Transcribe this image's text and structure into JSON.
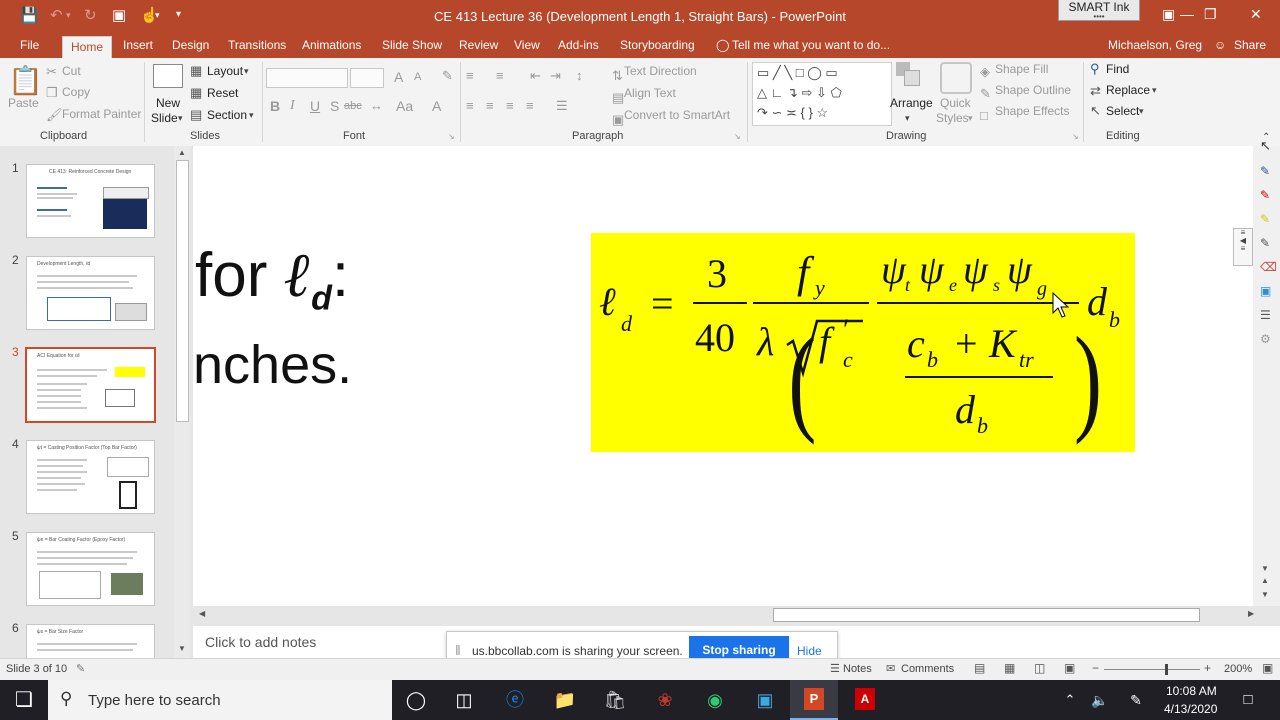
{
  "title_bar": {
    "title": "CE 413 Lecture 36 (Development Length 1, Straight Bars) - PowerPoint",
    "smart_ink_label": "SMART Ink"
  },
  "tabs": [
    {
      "label": "File"
    },
    {
      "label": "Home"
    },
    {
      "label": "Insert"
    },
    {
      "label": "Design"
    },
    {
      "label": "Transitions"
    },
    {
      "label": "Animations"
    },
    {
      "label": "Slide Show"
    },
    {
      "label": "Review"
    },
    {
      "label": "View"
    },
    {
      "label": "Add-ins"
    },
    {
      "label": "Storyboarding"
    }
  ],
  "tell_me": "Tell me what you want to do...",
  "user_name": "Michaelson, Greg",
  "share_label": "Share",
  "ribbon": {
    "clipboard": {
      "paste": "Paste",
      "cut": "Cut",
      "copy": "Copy",
      "format_painter": "Format Painter",
      "label": "Clipboard"
    },
    "slides": {
      "new_slide_1": "New",
      "new_slide_2": "Slide",
      "layout": "Layout",
      "reset": "Reset",
      "section": "Section",
      "label": "Slides"
    },
    "font": {
      "label": "Font",
      "bold": "B",
      "italic": "I",
      "underline": "U",
      "strike": "S",
      "shadow": "abc",
      "grow": "A",
      "shrink": "A",
      "case": "Aa",
      "clear": "A"
    },
    "paragraph": {
      "text_direction": "Text Direction",
      "align_text": "Align Text",
      "convert_smartart": "Convert to SmartArt",
      "label": "Paragraph"
    },
    "drawing": {
      "arrange": "Arrange",
      "quick_styles_1": "Quick",
      "quick_styles_2": "Styles",
      "shape_fill": "Shape Fill",
      "shape_outline": "Shape Outline",
      "shape_effects": "Shape Effects",
      "label": "Drawing"
    },
    "editing": {
      "find": "Find",
      "replace": "Replace",
      "select": "Select",
      "label": "Editing"
    }
  },
  "thumbnails": [
    {
      "num": "1",
      "title": "CE 413: Reinforced Concrete Design"
    },
    {
      "num": "2",
      "title": "Development Length, ℓd"
    },
    {
      "num": "3",
      "title": "ACI Equation for ℓd"
    },
    {
      "num": "4",
      "title": "ψt = Casting Position Factor (Top Bar Factor)"
    },
    {
      "num": "5",
      "title": "ψe = Bar Coating Factor (Epoxy Factor)"
    },
    {
      "num": "6",
      "title": "ψs = Bar Size Factor"
    }
  ],
  "slide": {
    "text_line1": "for ",
    "text_line1_sym": "ℓ",
    "text_line1_sub": "d",
    "text_line1_end": ":",
    "text_line2": "nches."
  },
  "formula": {
    "lhs": "ℓ",
    "lhs_sub": "d",
    "equals": "=",
    "num1": "3",
    "den1": "40",
    "f": "f",
    "f_sub": "y",
    "lambda": "λ",
    "fc": "f",
    "fc_prime": "′",
    "fc_sub": "c",
    "psi_t": "t",
    "psi_e": "e",
    "psi_s": "s",
    "psi_g": "g",
    "psi": "ψ",
    "c": "c",
    "c_sub": "b",
    "plus": "+",
    "K": "K",
    "K_sub": "tr",
    "d": "d",
    "d_sub": "b"
  },
  "notes_placeholder": "Click to add notes",
  "sharing": {
    "message": "us.bbcollab.com is sharing your screen.",
    "stop": "Stop sharing",
    "hide": "Hide"
  },
  "status": {
    "slide_info": "Slide 3 of 10",
    "notes": "Notes",
    "comments": "Comments",
    "zoom": "200%"
  },
  "taskbar": {
    "search_placeholder": "Type here to search",
    "time": "10:08 AM",
    "date": "4/13/2020"
  }
}
